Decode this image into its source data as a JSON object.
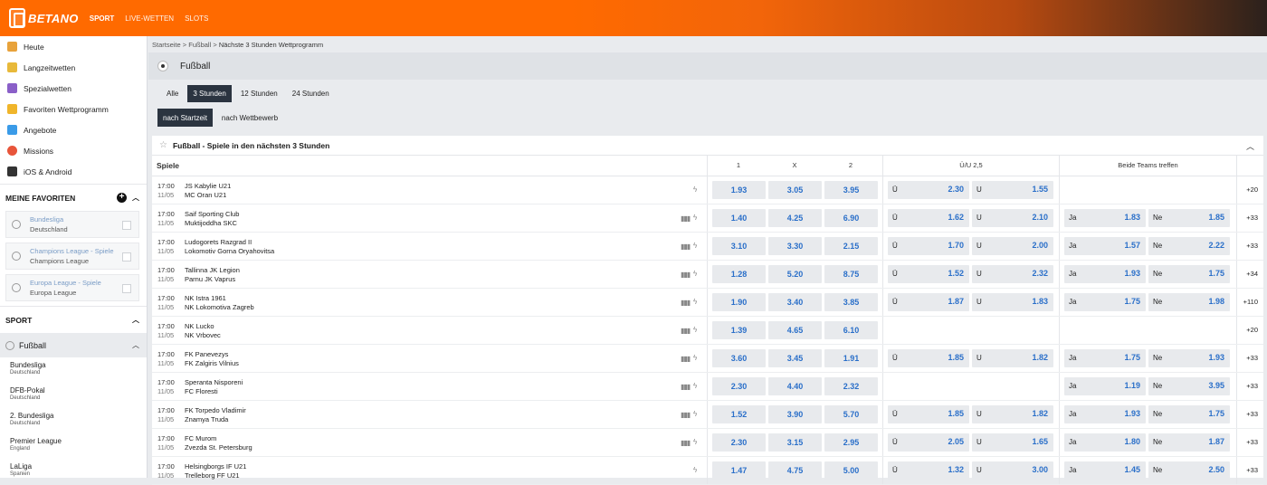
{
  "brand": "BETANO",
  "nav": [
    "SPORT",
    "LIVE-WETTEN",
    "SLOTS"
  ],
  "sidebar": {
    "items": [
      {
        "label": "Heute",
        "color": "#e8a23a"
      },
      {
        "label": "Langzeitwetten",
        "color": "#e8b93a"
      },
      {
        "label": "Spezialwetten",
        "color": "#8a5fc8"
      },
      {
        "label": "Favoriten Wettprogramm",
        "color": "#f0b52a"
      },
      {
        "label": "Angebote",
        "color": "#3a9be8"
      },
      {
        "label": "Missions",
        "color": "#e8553a"
      },
      {
        "label": "iOS & Android",
        "color": "#333333"
      }
    ],
    "favorites_title": "MEINE FAVORITEN",
    "favorites": [
      {
        "league": "Bundesliga",
        "country": "Deutschland"
      },
      {
        "league": "Champions League - Spiele",
        "country": "Champions League"
      },
      {
        "league": "Europa League - Spiele",
        "country": "Europa League"
      }
    ],
    "sport_title": "SPORT",
    "sport_selected": "Fußball",
    "leagues": [
      {
        "name": "Bundesliga",
        "country": "Deutschland"
      },
      {
        "name": "DFB-Pokal",
        "country": "Deutschland"
      },
      {
        "name": "2. Bundesliga",
        "country": "Deutschland"
      },
      {
        "name": "Premier League",
        "country": "England"
      },
      {
        "name": "LaLiga",
        "country": "Spanien"
      }
    ]
  },
  "breadcrumb": {
    "a": "Startseite",
    "b": "Fußball",
    "c": "Nächste 3 Stunden Wettprogramm"
  },
  "page_title": "Fußball",
  "time_tabs": [
    "Alle",
    "3 Stunden",
    "12 Stunden",
    "24 Stunden"
  ],
  "time_tab_selected": 1,
  "sort_tabs": [
    "nach Startzeit",
    "nach Wettbewerb"
  ],
  "sort_tab_selected": 0,
  "panel_title": "Fußball - Spiele in den nächsten 3 Stunden",
  "columns": {
    "spiele": "Spiele",
    "one": "1",
    "x": "X",
    "two": "2",
    "ou": "Ü/U 2,5",
    "btts": "Beide Teams treffen"
  },
  "ou_labels": {
    "over": "Ü",
    "under": "U"
  },
  "btts_labels": {
    "yes": "Ja",
    "no": "Ne"
  },
  "matches": [
    {
      "time": "17:00",
      "date": "11/05",
      "home": "JS Kabylie U21",
      "away": "MC Oran U21",
      "stats": false,
      "odds": [
        "1.93",
        "3.05",
        "3.95"
      ],
      "ou": [
        "2.30",
        "1.55"
      ],
      "btts": null,
      "more": "+20"
    },
    {
      "time": "17:00",
      "date": "11/05",
      "home": "Saif Sporting Club",
      "away": "Muktijoddha SKC",
      "stats": true,
      "odds": [
        "1.40",
        "4.25",
        "6.90"
      ],
      "ou": [
        "1.62",
        "2.10"
      ],
      "btts": [
        "1.83",
        "1.85"
      ],
      "more": "+33"
    },
    {
      "time": "17:00",
      "date": "11/05",
      "home": "Ludogorets Razgrad II",
      "away": "Lokomotiv Gorna Oryahovitsa",
      "stats": true,
      "odds": [
        "3.10",
        "3.30",
        "2.15"
      ],
      "ou": [
        "1.70",
        "2.00"
      ],
      "btts": [
        "1.57",
        "2.22"
      ],
      "more": "+33"
    },
    {
      "time": "17:00",
      "date": "11/05",
      "home": "Tallinna JK Legion",
      "away": "Parnu JK Vaprus",
      "stats": true,
      "odds": [
        "1.28",
        "5.20",
        "8.75"
      ],
      "ou": [
        "1.52",
        "2.32"
      ],
      "btts": [
        "1.93",
        "1.75"
      ],
      "more": "+34"
    },
    {
      "time": "17:00",
      "date": "11/05",
      "home": "NK Istra 1961",
      "away": "NK Lokomotiva Zagreb",
      "stats": true,
      "odds": [
        "1.90",
        "3.40",
        "3.85"
      ],
      "ou": [
        "1.87",
        "1.83"
      ],
      "btts": [
        "1.75",
        "1.98"
      ],
      "more": "+110"
    },
    {
      "time": "17:00",
      "date": "11/05",
      "home": "NK Lucko",
      "away": "NK Vrbovec",
      "stats": true,
      "odds": [
        "1.39",
        "4.65",
        "6.10"
      ],
      "ou": null,
      "btts": null,
      "more": "+20"
    },
    {
      "time": "17:00",
      "date": "11/05",
      "home": "FK Panevezys",
      "away": "FK Zalgiris Vilnius",
      "stats": true,
      "odds": [
        "3.60",
        "3.45",
        "1.91"
      ],
      "ou": [
        "1.85",
        "1.82"
      ],
      "btts": [
        "1.75",
        "1.93"
      ],
      "more": "+33"
    },
    {
      "time": "17:00",
      "date": "11/05",
      "home": "Speranta Nisporeni",
      "away": "FC Floresti",
      "stats": true,
      "odds": [
        "2.30",
        "4.40",
        "2.32"
      ],
      "ou": null,
      "btts": [
        "1.19",
        "3.95"
      ],
      "more": "+33"
    },
    {
      "time": "17:00",
      "date": "11/05",
      "home": "FK Torpedo Vladimir",
      "away": "Znamya Truda",
      "stats": true,
      "odds": [
        "1.52",
        "3.90",
        "5.70"
      ],
      "ou": [
        "1.85",
        "1.82"
      ],
      "btts": [
        "1.93",
        "1.75"
      ],
      "more": "+33"
    },
    {
      "time": "17:00",
      "date": "11/05",
      "home": "FC Murom",
      "away": "Zvezda St. Petersburg",
      "stats": true,
      "odds": [
        "2.30",
        "3.15",
        "2.95"
      ],
      "ou": [
        "2.05",
        "1.65"
      ],
      "btts": [
        "1.80",
        "1.87"
      ],
      "more": "+33"
    },
    {
      "time": "17:00",
      "date": "11/05",
      "home": "Helsingborgs IF U21",
      "away": "Trelleborg FF U21",
      "stats": false,
      "odds": [
        "1.47",
        "4.75",
        "5.00"
      ],
      "ou": [
        "1.32",
        "3.00"
      ],
      "btts": [
        "1.45",
        "2.50"
      ],
      "more": "+33"
    }
  ]
}
